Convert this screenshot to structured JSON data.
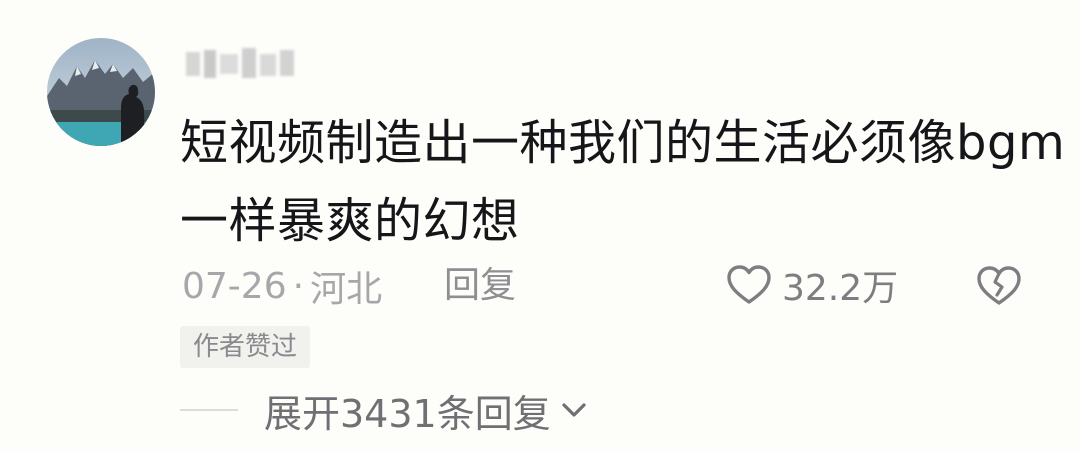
{
  "comment": {
    "username": "",
    "text_lines": [
      "短视频制造出一种我们的生活必须像bgm",
      "一样暴爽的幻想"
    ],
    "date": "07-26",
    "separator": "·",
    "location": "河北",
    "reply_label": "回复",
    "like_count": "32.2万",
    "author_badge": "作者赞过",
    "expand_label": "展开3431条回复"
  },
  "icons": {
    "like": "heart-outline-icon",
    "dislike": "broken-heart-icon",
    "expand": "chevron-down-icon"
  },
  "colors": {
    "background": "#fdfdf9",
    "text_primary": "#16161a",
    "text_secondary": "#a7a7ab",
    "badge_bg": "#f1f1ee"
  }
}
